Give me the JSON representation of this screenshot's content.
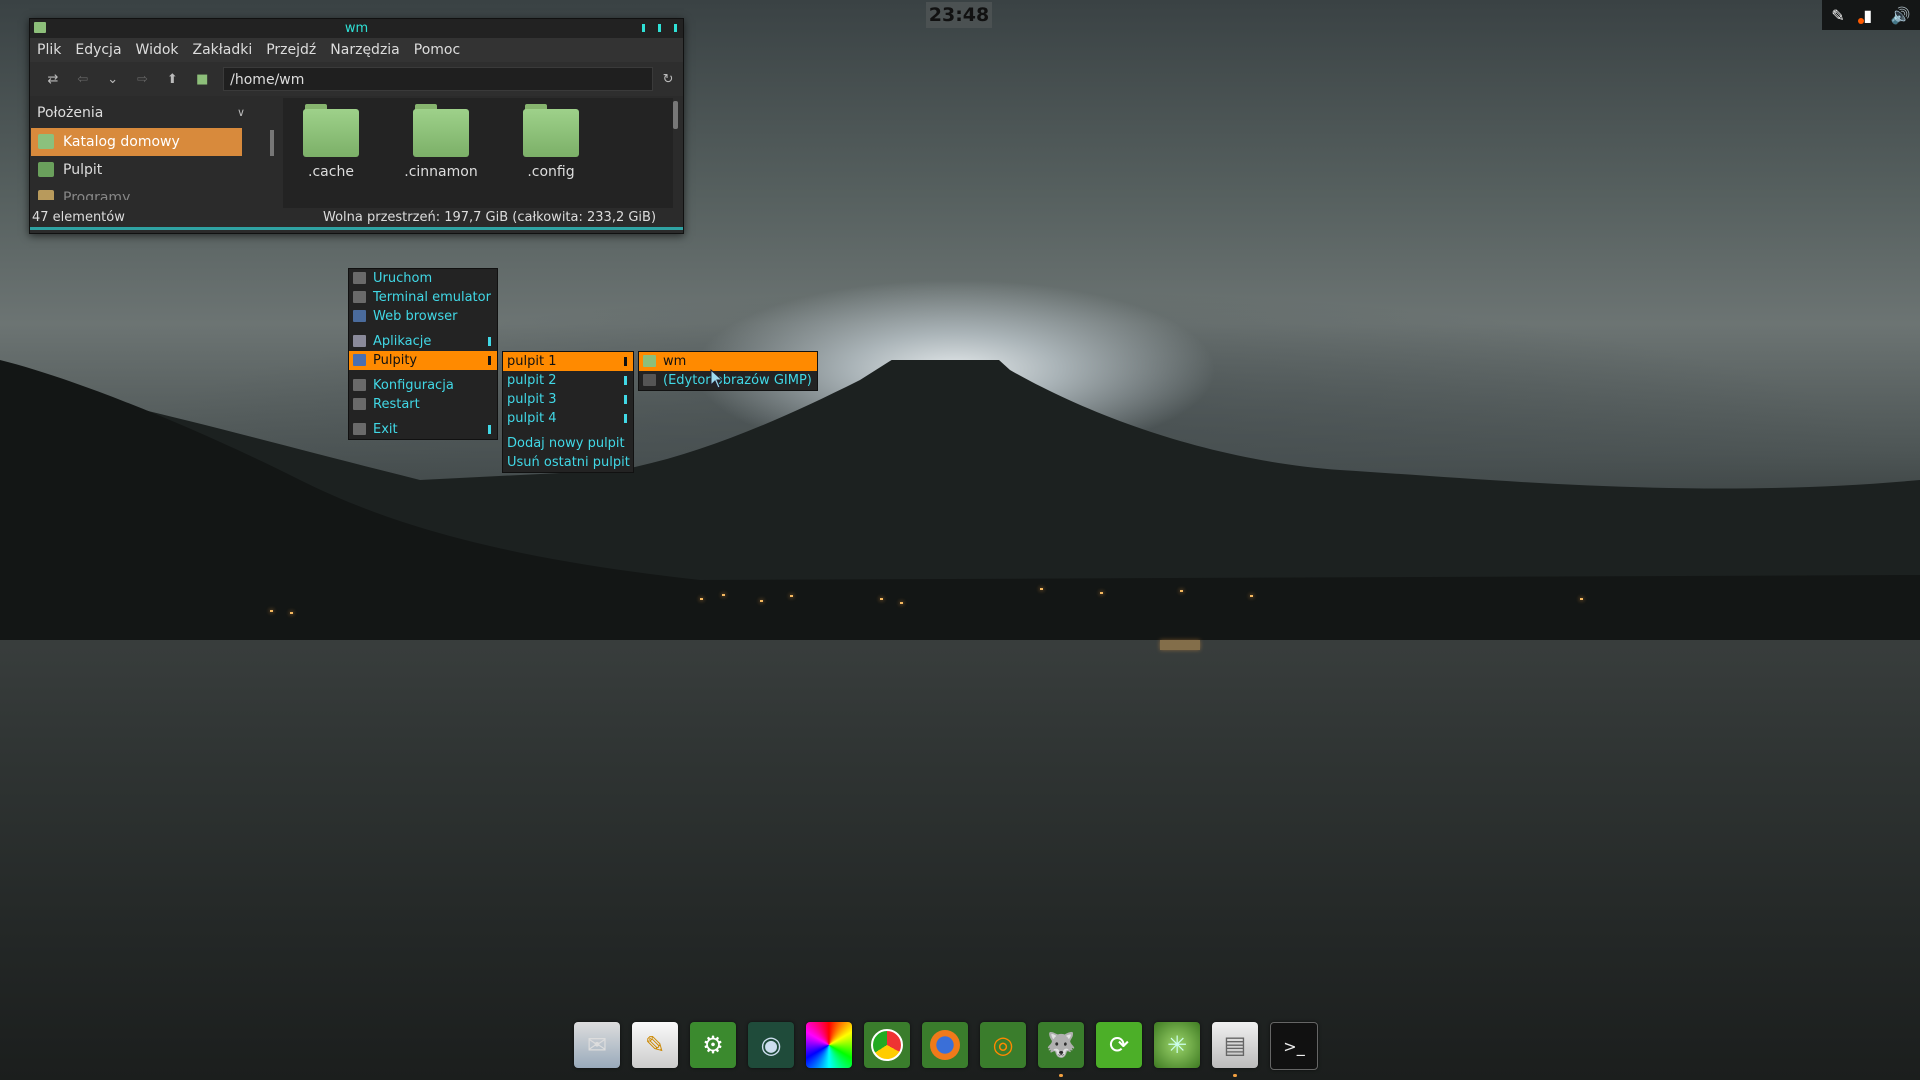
{
  "clock": "23:48",
  "file_manager": {
    "title": "wm",
    "menu": [
      "Plik",
      "Edycja",
      "Widok",
      "Zakładki",
      "Przejdź",
      "Narzędzia",
      "Pomoc"
    ],
    "path": "/home/wm",
    "sidebar": {
      "header": "Położenia",
      "items": [
        {
          "label": "Katalog domowy",
          "selected": true
        },
        {
          "label": "Pulpit",
          "selected": false
        },
        {
          "label": "Programy",
          "selected": false
        }
      ]
    },
    "folders": [
      ".cache",
      ".cinnamon",
      ".config"
    ],
    "status_left": "47 elementów",
    "status_right": "Wolna przestrzeń: 197,7 GiB (całkowita: 233,2 GiB)"
  },
  "menu_main": {
    "items": [
      {
        "label": "Uruchom",
        "icon": "run-icon"
      },
      {
        "label": "Terminal emulator",
        "icon": "terminal-icon"
      },
      {
        "label": "Web browser",
        "icon": "browser-icon"
      },
      {
        "label": "Aplikacje",
        "icon": "apps-icon"
      },
      {
        "label": "Pulpity",
        "icon": "desktops-icon"
      },
      {
        "label": "Konfiguracja",
        "icon": "gear-icon"
      },
      {
        "label": "Restart",
        "icon": "restart-icon"
      },
      {
        "label": "Exit",
        "icon": "exit-icon"
      }
    ]
  },
  "menu_desktops": {
    "items": [
      "pulpit 1",
      "pulpit 2",
      "pulpit 3",
      "pulpit 4"
    ],
    "actions": [
      "Dodaj nowy pulpit",
      "Usuń ostatni pulpit"
    ]
  },
  "menu_windows": {
    "items": [
      "wm",
      "(Edytor obrazów GIMP)"
    ]
  },
  "colors": {
    "accent": "#ff8a00",
    "menu_text": "#41d8e6",
    "selection": "#d88a3c",
    "title_text": "#2fe1d6"
  },
  "dock": [
    {
      "icon": "mail-icon"
    },
    {
      "icon": "text-editor-icon"
    },
    {
      "icon": "settings-icon"
    },
    {
      "icon": "screenshot-icon"
    },
    {
      "icon": "color-picker-icon"
    },
    {
      "icon": "chrome-icon"
    },
    {
      "icon": "firefox-icon"
    },
    {
      "icon": "blender-icon"
    },
    {
      "icon": "gimp-icon"
    },
    {
      "icon": "sync-icon"
    },
    {
      "icon": "pinwheel-icon"
    },
    {
      "icon": "file-manager-icon"
    },
    {
      "icon": "terminal-icon"
    }
  ]
}
